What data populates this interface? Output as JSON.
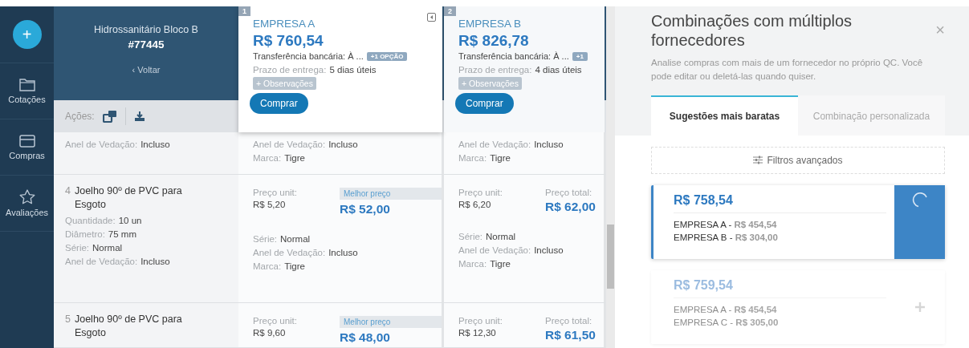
{
  "nav": {
    "add_button": "+",
    "items": [
      {
        "kind": "folder",
        "label": "Cotações"
      },
      {
        "kind": "card",
        "label": "Compras"
      },
      {
        "kind": "star",
        "label": "Avaliações"
      }
    ]
  },
  "quote": {
    "title": "Hidrossanitário Bloco B",
    "number": "#77445",
    "back": "‹ Voltar",
    "actions_label": "Ações:"
  },
  "suppliers": [
    {
      "index": "1",
      "name": "EMPRESA A",
      "total": "R$ 760,54",
      "payment": "Transferência bancária: À ...",
      "option_badge": "+1 OPÇÃO",
      "delivery_label": "Prazo de entrega:",
      "delivery": "5 dias úteis",
      "notes": "+ Observações",
      "buy": "Comprar",
      "collapsible": true
    },
    {
      "index": "2",
      "name": "EMPRESA B",
      "total": "R$ 826,78",
      "payment": "Transferência bancária: À ...",
      "option_badge": "+1",
      "delivery_label": "Prazo de entrega:",
      "delivery": "4 dias úteis",
      "notes": "+ Observações",
      "buy": "Comprar",
      "collapsible": false
    }
  ],
  "rows": [
    {
      "specs": [
        {
          "label": "Anel de Vedação:",
          "value": "Incluso"
        }
      ],
      "quotes": [
        {
          "specs": [
            {
              "label": "Anel de Vedação:",
              "value": "Incluso"
            },
            {
              "label": "Marca:",
              "value": "Tigre"
            }
          ]
        },
        {
          "specs": [
            {
              "label": "Anel de Vedação:",
              "value": "Incluso"
            },
            {
              "label": "Marca:",
              "value": "Tigre"
            }
          ]
        }
      ]
    },
    {
      "number": "4",
      "name": "Joelho 90º de PVC para Esgoto",
      "specs": [
        {
          "label": "Quantidade:",
          "value": "10 un"
        },
        {
          "label": "Diâmetro:",
          "value": "75 mm"
        },
        {
          "label": "Série:",
          "value": "Normal"
        },
        {
          "label": "Anel de Vedação:",
          "value": "Incluso"
        }
      ],
      "quotes": [
        {
          "unit_label": "Preço unit:",
          "unit": "R$ 5,20",
          "best": true,
          "total_label": "Melhor preço",
          "total": "R$ 52,00",
          "specs": [
            {
              "label": "Série:",
              "value": "Normal"
            },
            {
              "label": "Anel de Vedação:",
              "value": "Incluso"
            },
            {
              "label": "Marca:",
              "value": "Tigre"
            }
          ]
        },
        {
          "unit_label": "Preço unit:",
          "unit": "R$ 6,20",
          "best": false,
          "total_label": "Preço total:",
          "total": "R$ 62,00",
          "specs": [
            {
              "label": "Série:",
              "value": "Normal"
            },
            {
              "label": "Anel de Vedação:",
              "value": "Incluso"
            },
            {
              "label": "Marca:",
              "value": "Tigre"
            }
          ]
        }
      ]
    },
    {
      "number": "5",
      "name": "Joelho 90º de PVC para Esgoto",
      "quotes": [
        {
          "unit_label": "Preço unit:",
          "unit": "R$ 9,60",
          "best": true,
          "total_label": "Melhor preço",
          "total": "R$ 48,00"
        },
        {
          "unit_label": "Preço unit:",
          "unit": "R$ 12,30",
          "best": false,
          "total_label": "Preço total:",
          "total": "R$ 61,50"
        }
      ]
    }
  ],
  "panel": {
    "title": "Combinações com múltiplos fornecedores",
    "close": "×",
    "description": "Analise compras com mais de um fornecedor no próprio QC. Você pode editar ou deletá-las quando quiser.",
    "tabs": [
      {
        "label": "Sugestões mais baratas",
        "selected": true
      },
      {
        "label": "Combinação personalizada",
        "selected": false
      }
    ],
    "filter_button": "Filtros avançados",
    "combinations": [
      {
        "total": "R$ 758,54",
        "selected": true,
        "kind": "loading",
        "lines": [
          {
            "company": "EMPRESA A -",
            "price": "R$ 454,54"
          },
          {
            "company": "EMPRESA B -",
            "price": "R$ 304,00"
          }
        ]
      },
      {
        "total": "R$ 759,54",
        "selected": false,
        "kind": "add",
        "lines": [
          {
            "company": "EMPRESA A -",
            "price": "R$ 454,54"
          },
          {
            "company": "EMPRESA C -",
            "price": "R$ 305,00"
          }
        ]
      }
    ]
  }
}
